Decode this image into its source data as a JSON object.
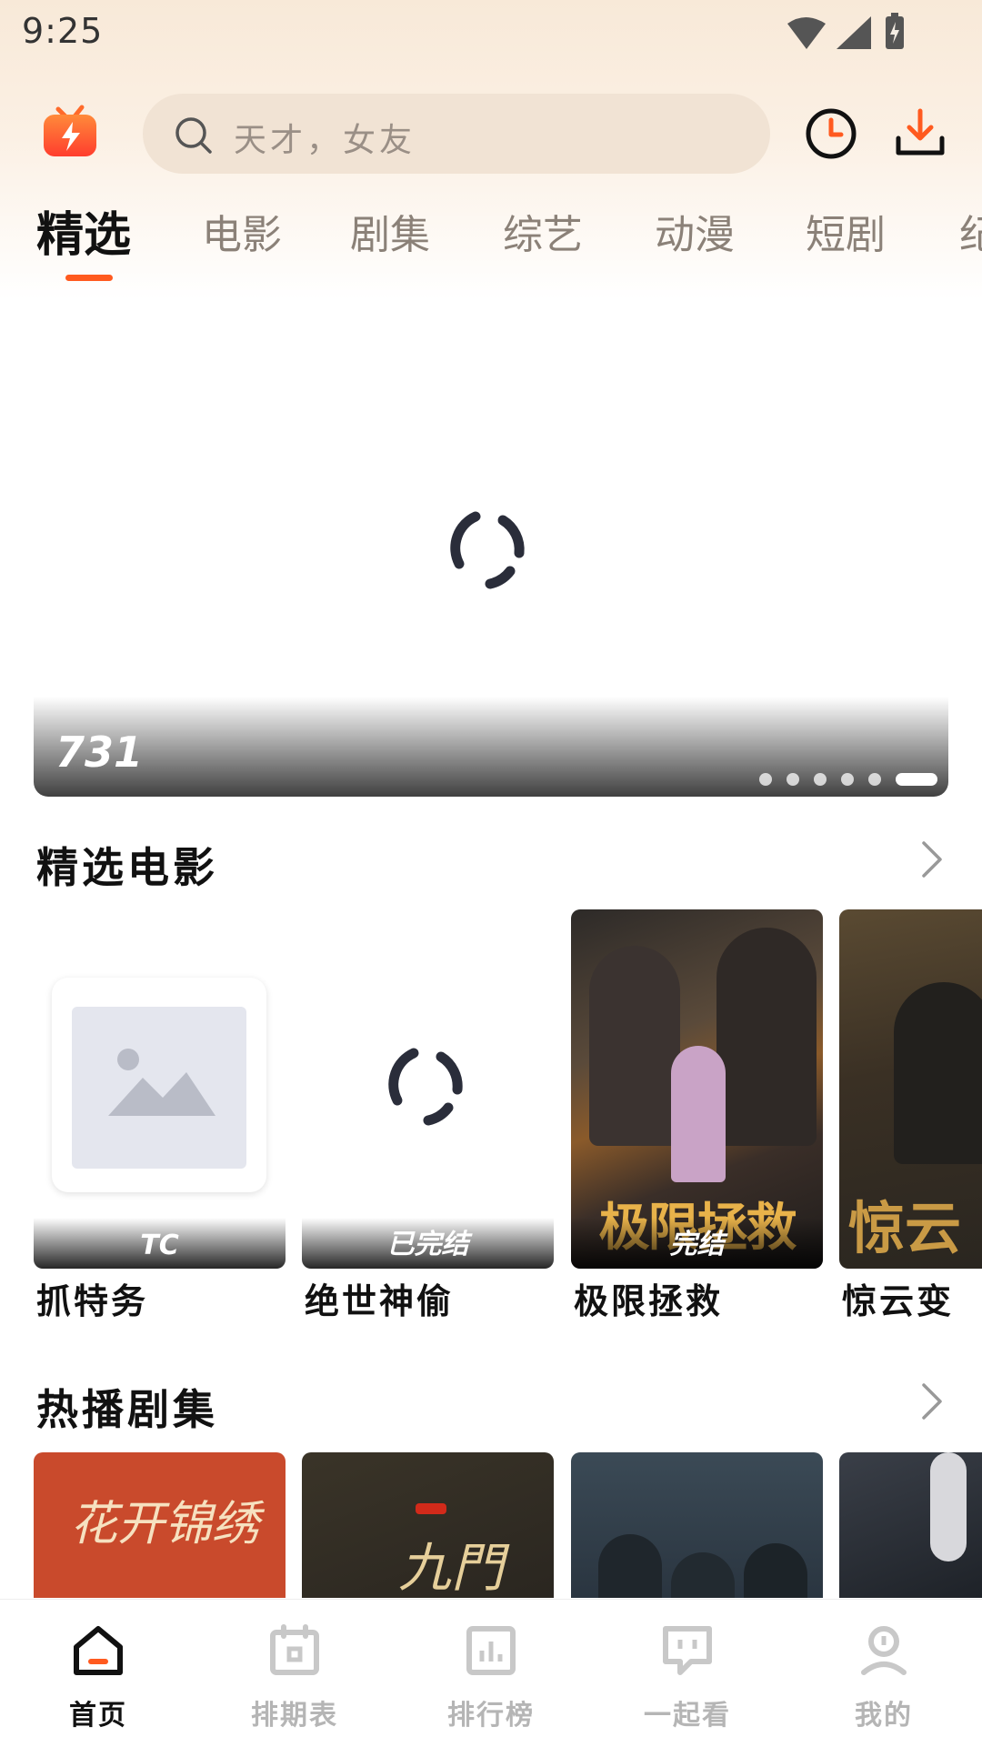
{
  "status_bar": {
    "time": "9:25"
  },
  "header": {
    "search_placeholder": "天才，女友"
  },
  "tabs": [
    {
      "label": "精选",
      "active": true
    },
    {
      "label": "电影"
    },
    {
      "label": "剧集"
    },
    {
      "label": "综艺"
    },
    {
      "label": "动漫"
    },
    {
      "label": "短剧"
    },
    {
      "label": "纪"
    }
  ],
  "banner": {
    "number": "731",
    "slide_count": 6,
    "active_slide": 6
  },
  "sections": {
    "movies": {
      "title": "精选电影",
      "items": [
        {
          "title": "抓特务",
          "tag": "TC"
        },
        {
          "title": "绝世神偷",
          "tag": "已完结"
        },
        {
          "title": "极限拯救",
          "tag": "完结",
          "poster_text": "极限拯救"
        },
        {
          "title": "惊云变",
          "poster_text": "惊云"
        }
      ]
    },
    "series": {
      "title": "热播剧集",
      "items": [
        {
          "poster_text": "花开锦绣"
        },
        {
          "poster_text": "九門"
        },
        {},
        {}
      ]
    }
  },
  "nav": [
    {
      "label": "首页",
      "icon": "home-icon",
      "active": true
    },
    {
      "label": "排期表",
      "icon": "calendar-icon"
    },
    {
      "label": "排行榜",
      "icon": "chart-icon"
    },
    {
      "label": "一起看",
      "icon": "chat-icon"
    },
    {
      "label": "我的",
      "icon": "profile-icon"
    }
  ],
  "colors": {
    "accent": "#ff5a1f",
    "header_bg": "#f8e9d8"
  }
}
